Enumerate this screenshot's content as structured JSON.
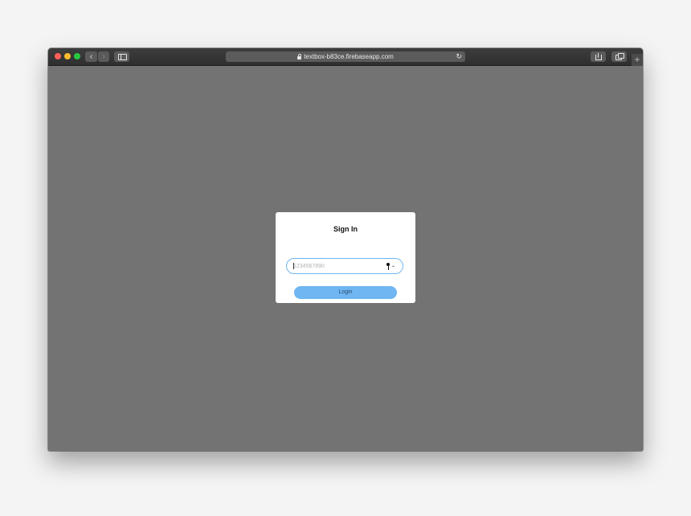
{
  "browser": {
    "url": "textbox-b83ce.firebaseapp.com",
    "back_glyph": "‹",
    "forward_glyph": "›",
    "reload_glyph": "↻",
    "newtab_glyph": "+"
  },
  "signin": {
    "title": "Sign In",
    "phone_placeholder": "1234567890",
    "login_label": "Login",
    "chevron_glyph": "⌄"
  },
  "colors": {
    "accent": "#6fb6f2",
    "page_background": "#737373",
    "toolbar": "#333333"
  },
  "icons": [
    "lock-icon",
    "reload-icon",
    "share-icon",
    "tabs-icon",
    "sidebar-icon",
    "key-icon",
    "chevron-down-icon"
  ]
}
